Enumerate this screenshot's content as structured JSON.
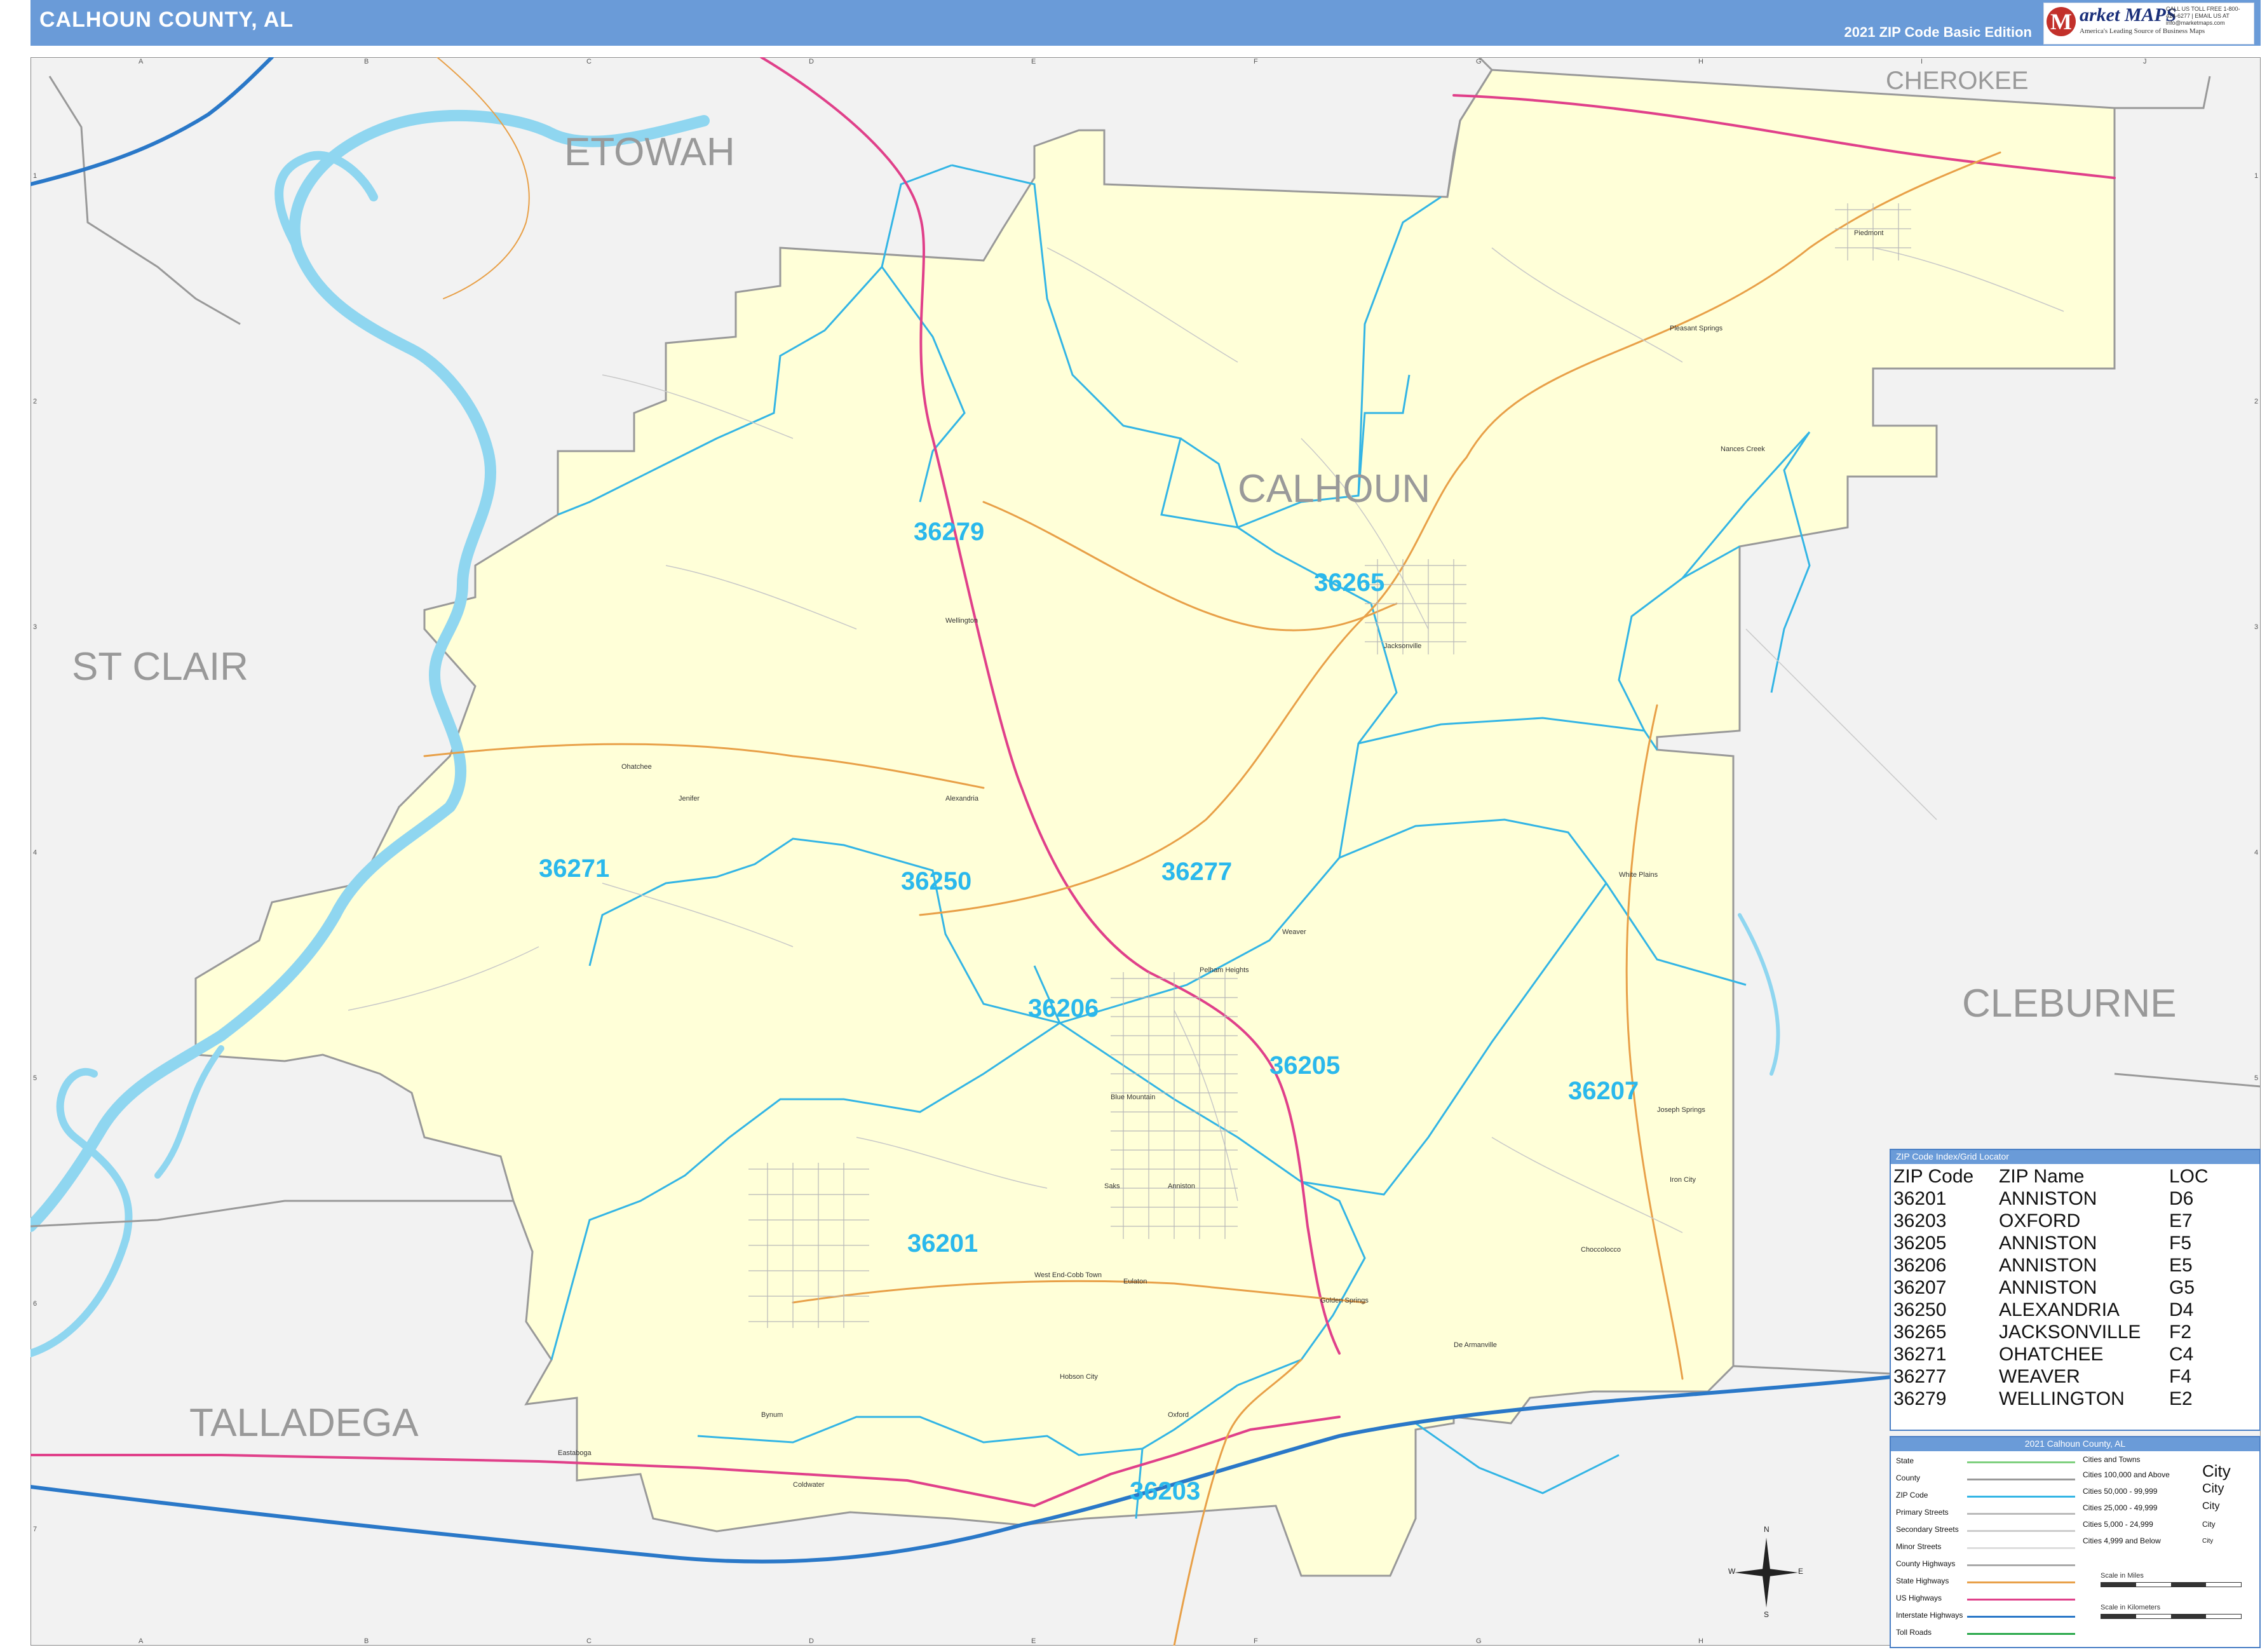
{
  "header": {
    "title": "CALHOUN COUNTY, AL",
    "edition": "2021 ZIP Code Basic Edition",
    "logo_mark": "M",
    "logo_name": "arket MAPS",
    "logo_tagline": "America's Leading Source of Business Maps",
    "logo_contact": "CALL US TOLL FREE 1-800-424-6277 | EMAIL US AT info@marketmaps.com"
  },
  "grid": {
    "columns": [
      "A",
      "B",
      "C",
      "D",
      "E",
      "F",
      "G",
      "H",
      "I",
      "J"
    ],
    "rows": [
      "1",
      "2",
      "3",
      "4",
      "5",
      "6",
      "7"
    ]
  },
  "counties": {
    "etowah": "ETOWAH",
    "cherokee": "CHEROKEE",
    "st_clair": "ST CLAIR",
    "calhoun": "CALHOUN",
    "cleburne": "CLEBURNE",
    "talladega": "TALLADEGA"
  },
  "zip_labels": {
    "z36279": "36279",
    "z36265": "36265",
    "z36271": "36271",
    "z36250": "36250",
    "z36277": "36277",
    "z36206": "36206",
    "z36205": "36205",
    "z36207": "36207",
    "z36201": "36201",
    "z36203": "36203"
  },
  "places": {
    "piedmont": "Piedmont",
    "jacksonville": "Jacksonville",
    "wellington": "Wellington",
    "alexandria": "Alexandria",
    "ohatchee": "Ohatchee",
    "weaver": "Weaver",
    "anniston": "Anniston",
    "oxford": "Oxford",
    "hobson_city": "Hobson City",
    "white_plains": "White Plains",
    "nances_creek": "Nances Creek",
    "blue_mountain": "Blue Mountain",
    "saks": "Saks",
    "west_end_cobb_town": "West End-Cobb Town",
    "choccolocco": "Choccolocco",
    "de_armanville": "De Armanville",
    "eulaton": "Eulaton",
    "bynum": "Bynum",
    "glencoe_road": "Pleasant Springs",
    "golden_springs": "Golden Springs",
    "iron_city": "Iron City",
    "jenifer": "Joseph Springs",
    "coldwater": "Coldwater",
    "mcfall": "Nances Creek",
    "pelham": "Pelham Heights",
    "eastaboga": "Eastaboga",
    "ohatchee_jct": "Jenifer"
  },
  "zip_index": {
    "title": "ZIP Code Index/Grid Locator",
    "headers": [
      "ZIP Code",
      "ZIP Name",
      "LOC"
    ],
    "rows": [
      [
        "36201",
        "ANNISTON",
        "D6"
      ],
      [
        "36203",
        "OXFORD",
        "E7"
      ],
      [
        "36205",
        "ANNISTON",
        "F5"
      ],
      [
        "36206",
        "ANNISTON",
        "E5"
      ],
      [
        "36207",
        "ANNISTON",
        "G5"
      ],
      [
        "36250",
        "ALEXANDRIA",
        "D4"
      ],
      [
        "36265",
        "JACKSONVILLE",
        "F2"
      ],
      [
        "36271",
        "OHATCHEE",
        "C4"
      ],
      [
        "36277",
        "WEAVER",
        "F4"
      ],
      [
        "36279",
        "WELLINGTON",
        "E2"
      ]
    ]
  },
  "legend": {
    "title": "2021 Calhoun County, AL",
    "items": [
      {
        "label": "State",
        "color": "#7ed07e"
      },
      {
        "label": "County",
        "color": "#999999"
      },
      {
        "label": "ZIP Code",
        "color": "#33b5e5"
      },
      {
        "label": "Primary Streets",
        "color": "#bbbbbb"
      },
      {
        "label": "Secondary Streets",
        "color": "#cccccc"
      },
      {
        "label": "Minor Streets",
        "color": "#dddddd"
      },
      {
        "label": "County Highways",
        "color": "#aaaaaa"
      },
      {
        "label": "State Highways",
        "color": "#e8a048"
      },
      {
        "label": "US Highways",
        "color": "#e0408a"
      },
      {
        "label": "Interstate Highways",
        "color": "#2a78c8"
      },
      {
        "label": "Toll Roads",
        "color": "#2aa84a"
      }
    ],
    "cities_title": "Cities and Towns",
    "cities": [
      {
        "label": "Cities 100,000 and Above",
        "sample": "City"
      },
      {
        "label": "Cities 50,000 - 99,999",
        "sample": "City"
      },
      {
        "label": "Cities 25,000 - 49,999",
        "sample": "City"
      },
      {
        "label": "Cities 5,000 - 24,999",
        "sample": "City"
      },
      {
        "label": "Cities 4,999 and Below",
        "sample": "City"
      }
    ],
    "scale_miles": "Scale in Miles",
    "scale_km": "Scale in Kilometers"
  },
  "compass": {
    "n": "N",
    "s": "S",
    "e": "E",
    "w": "W"
  },
  "colors": {
    "county_fill": "#ffffd8",
    "outside_fill": "#f2f2f2",
    "water": "#8fd6f0",
    "zip_line": "#33b5e5",
    "zip_text": "#2ab8ec",
    "county_text": "#999999",
    "header": "#6a9bd8"
  }
}
